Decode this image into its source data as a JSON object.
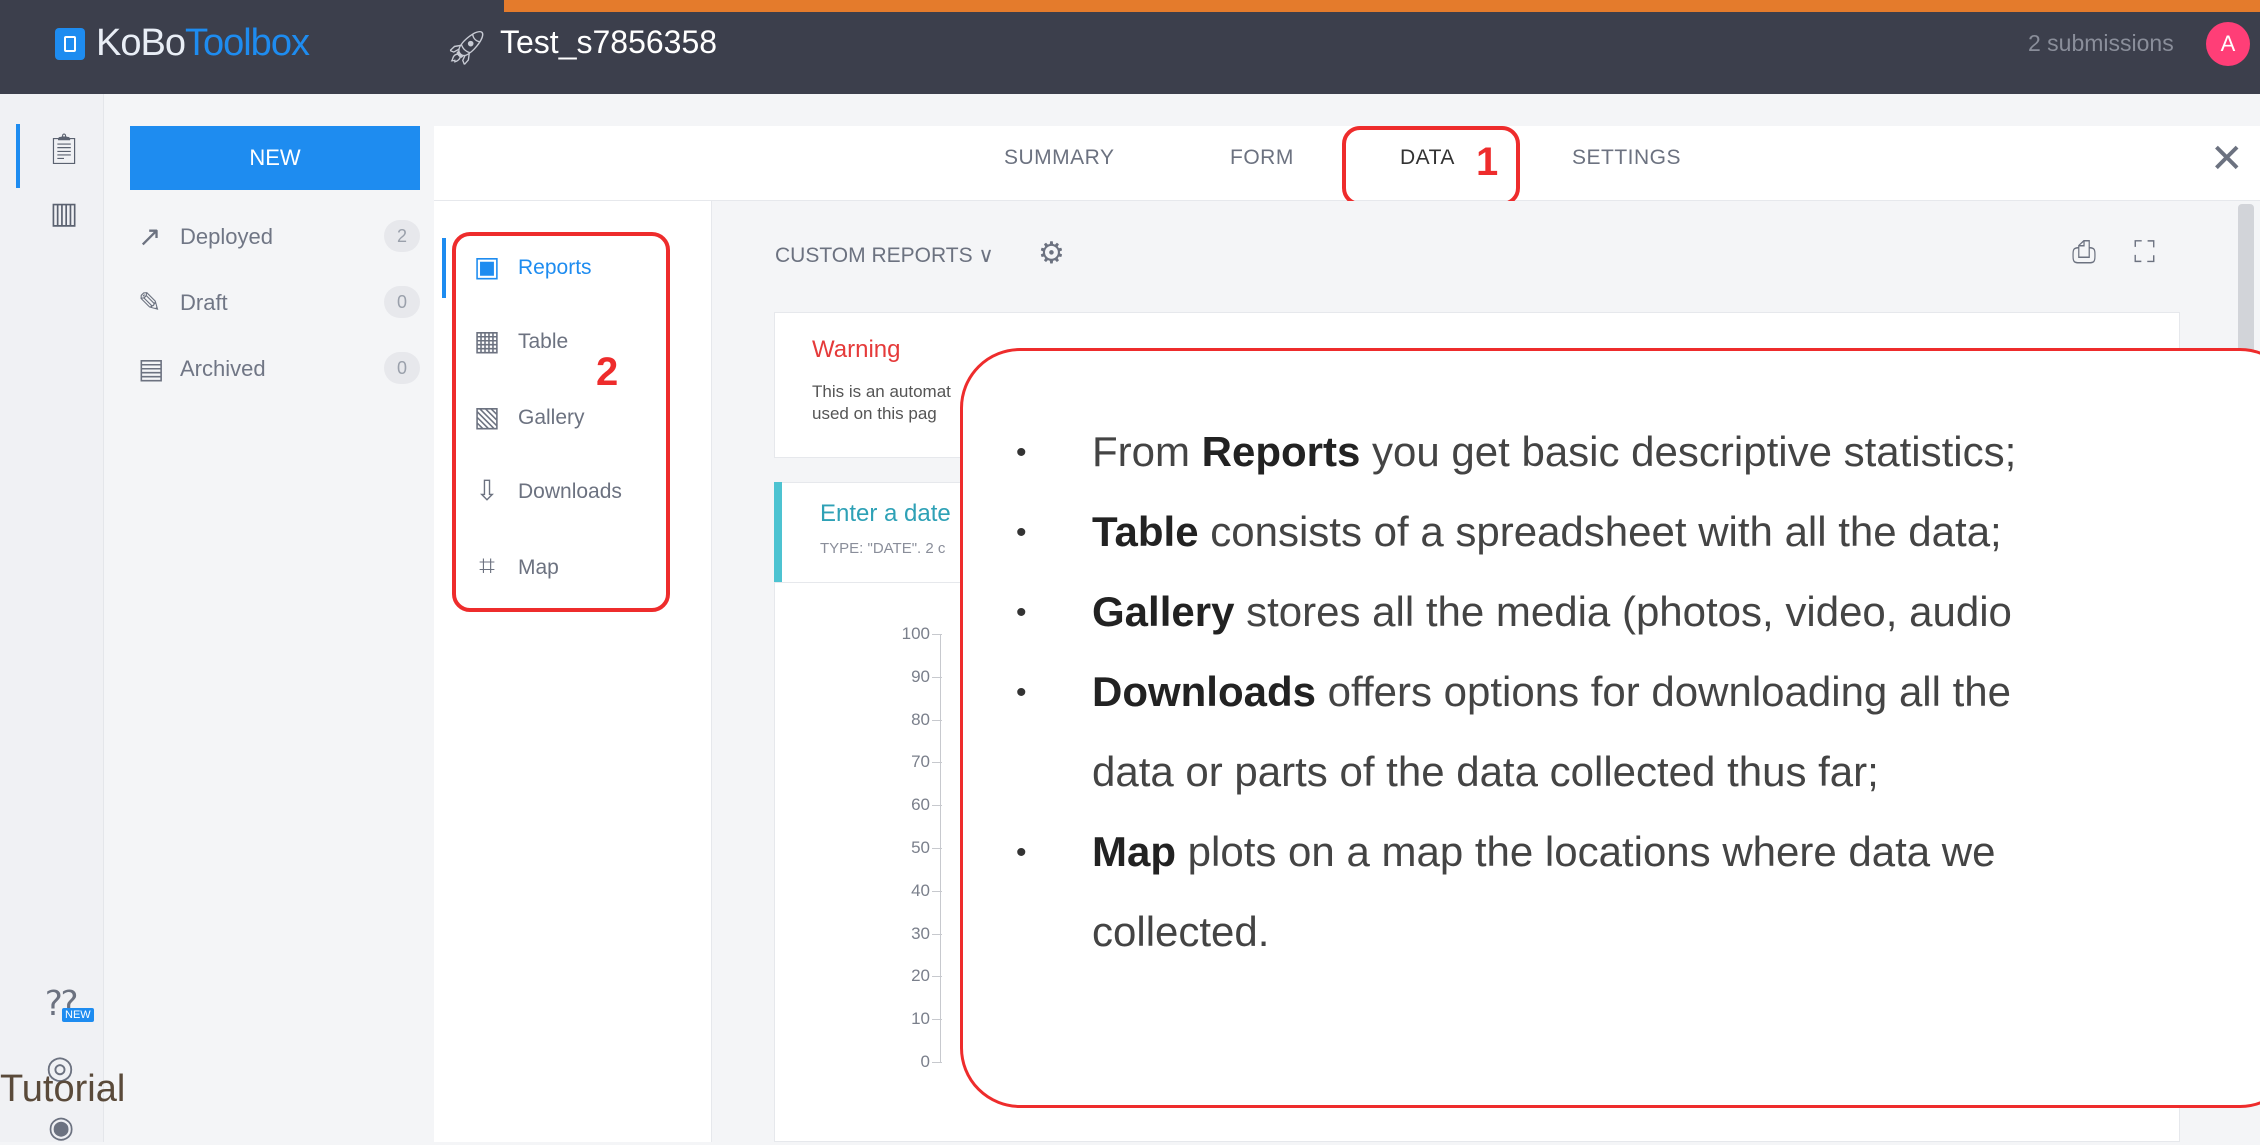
{
  "header": {
    "logo_prefix": "KoBo",
    "logo_suffix": "Toolbox",
    "project_title": "Test_s7856358",
    "submissions": "2 submissions",
    "avatar_initial": "A"
  },
  "sidebar": {
    "new_label": "NEW",
    "items": [
      {
        "label": "Deployed",
        "count": "2",
        "icon": "rocket-icon"
      },
      {
        "label": "Draft",
        "count": "0",
        "icon": "draft-icon"
      },
      {
        "label": "Archived",
        "count": "0",
        "icon": "archive-icon"
      }
    ]
  },
  "tabs": [
    {
      "label": "SUMMARY"
    },
    {
      "label": "FORM"
    },
    {
      "label": "DATA"
    },
    {
      "label": "SETTINGS"
    }
  ],
  "annotations": {
    "marker_1": "1",
    "marker_2": "2",
    "outline_color": "#ee2c2c"
  },
  "data_nav": [
    {
      "label": "Reports",
      "icon": "reports-icon"
    },
    {
      "label": "Table",
      "icon": "table-icon"
    },
    {
      "label": "Gallery",
      "icon": "gallery-icon"
    },
    {
      "label": "Downloads",
      "icon": "download-icon"
    },
    {
      "label": "Map",
      "icon": "map-icon"
    }
  ],
  "report": {
    "custom_reports_label": "CUSTOM REPORTS ∨",
    "warning_title": "Warning",
    "warning_line_1": "This is an automat",
    "warning_line_2": "used on this pag",
    "question_title": "Enter a date",
    "question_type": "TYPE: \"DATE\". 2 c",
    "y_ticks": [
      "100",
      "90",
      "80",
      "70",
      "60",
      "50",
      "40",
      "30",
      "20",
      "10",
      "0"
    ]
  },
  "callout": {
    "b1_bold": "Reports",
    "b1_pre": "From ",
    "b1_post": " you get basic descriptive statistics;",
    "b2_bold": "Table",
    "b2_post": " consists of a spreadsheet with all the data;",
    "b3_bold": "Gallery",
    "b3_post": " stores all the media (photos, video, audio",
    "b4_bold": "Downloads",
    "b4_post": " offers options for downloading all the",
    "b4_cont": "data or parts of the data collected thus far;",
    "b5_bold": "Map",
    "b5_post": " plots on a map the locations where data we",
    "b5_cont": "collected."
  },
  "footer": {
    "new_badge": "NEW",
    "tutorial": "Tutorial"
  },
  "colors": {
    "topbar": "#3c3f4c",
    "accent": "#e47b2c",
    "primary": "#1e8cf0",
    "warning": "#e53a3a",
    "question": "#2ea1b6"
  }
}
